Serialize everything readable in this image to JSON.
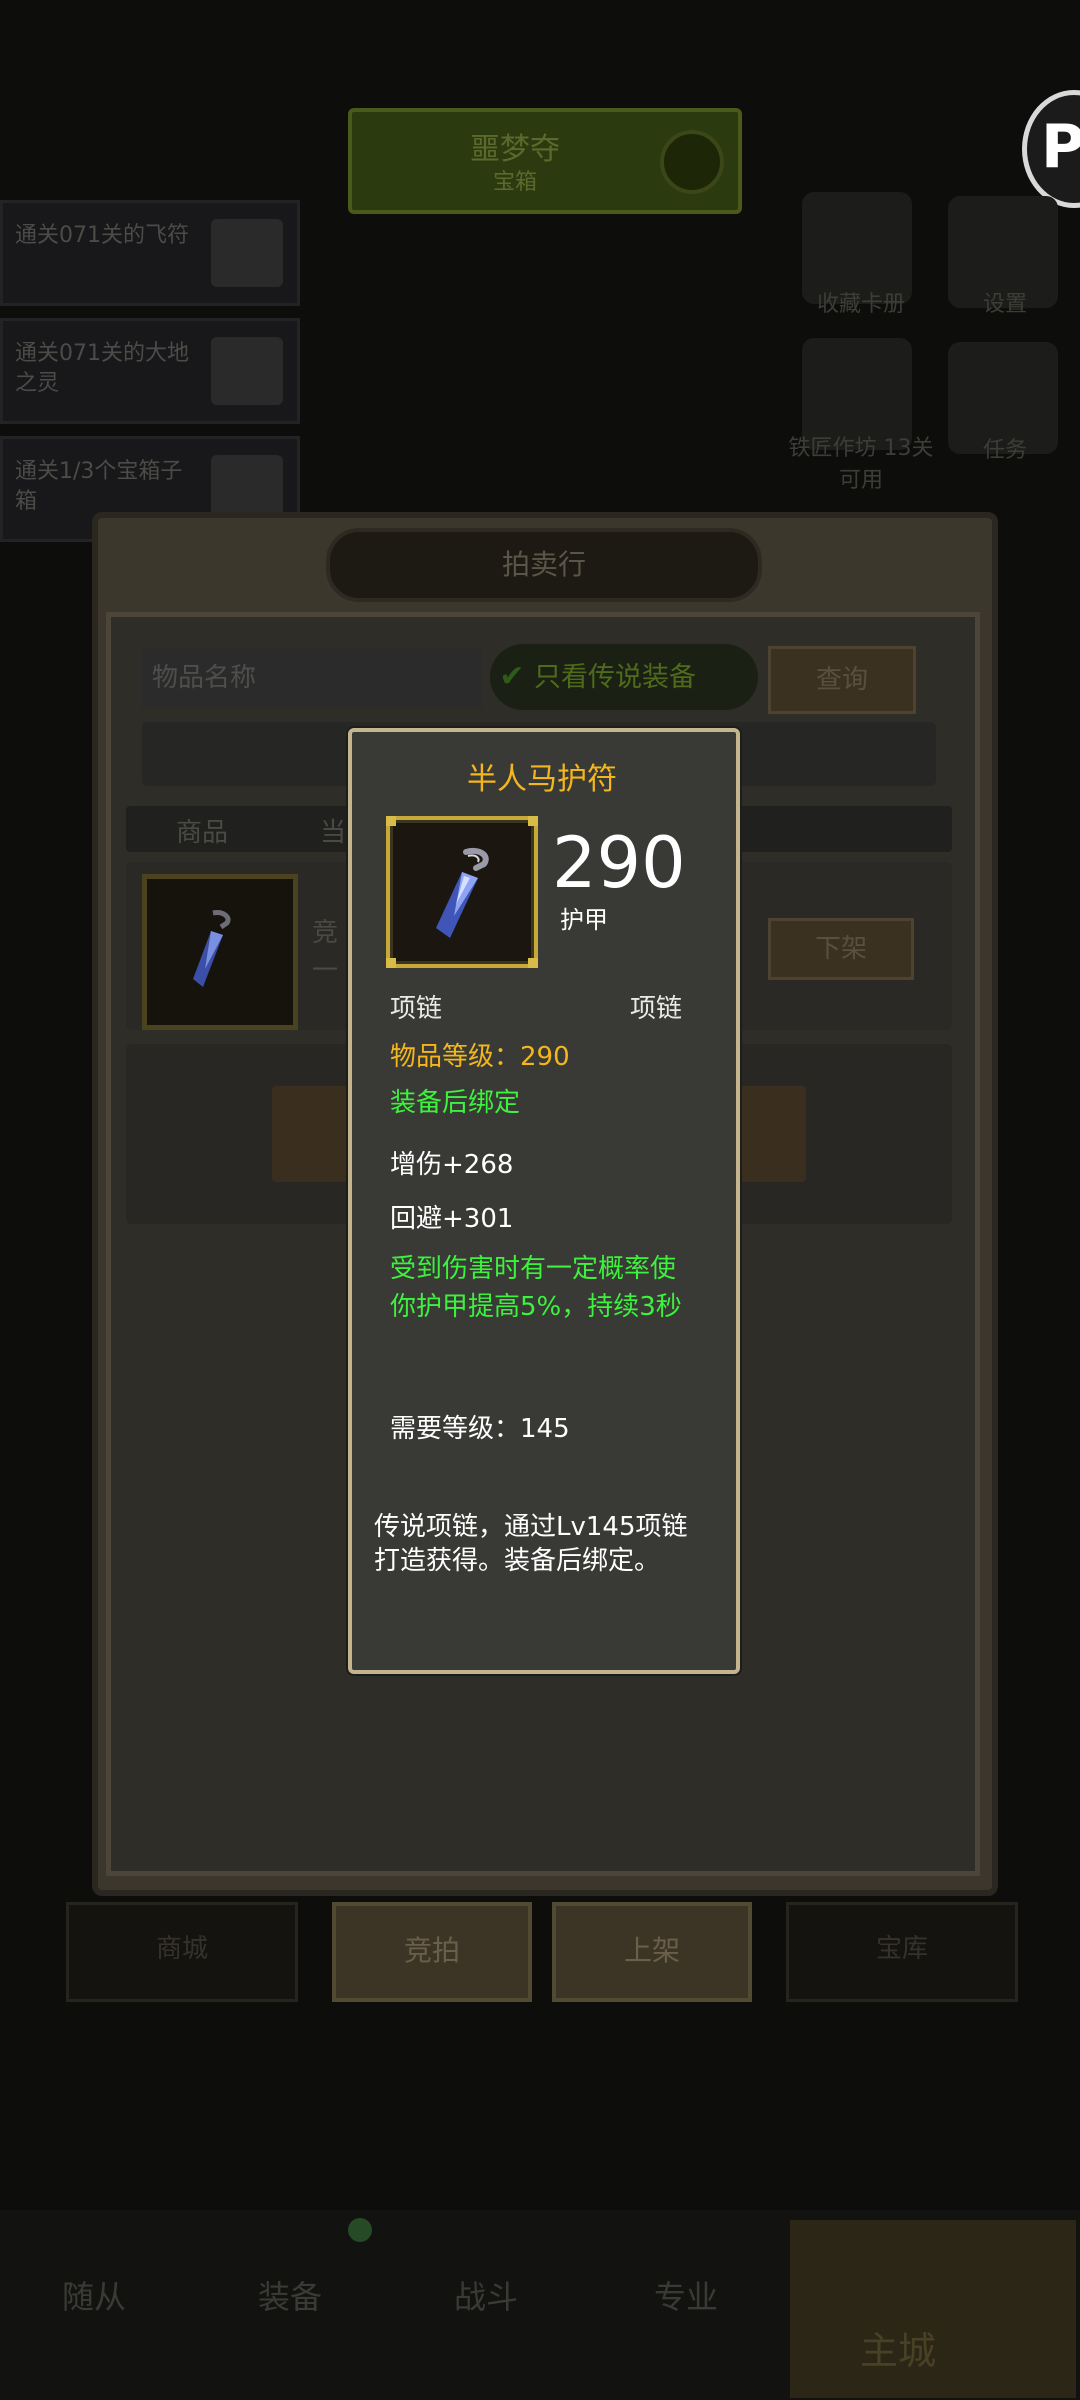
{
  "background": {
    "banner": {
      "line1": "噩梦夺",
      "line2": "宝箱"
    },
    "quests": [
      {
        "text": "通关071关的飞符"
      },
      {
        "text": "通关071关的大地之灵"
      },
      {
        "text": "通关1/3个宝箱子箱"
      }
    ],
    "side_labels": [
      "收藏卡册",
      "设置",
      "铁匠作坊 13关可用",
      "任务"
    ],
    "corner_logo": "P"
  },
  "auction": {
    "title": "拍卖行",
    "search_placeholder": "物品名称",
    "legendary_only_label": "只看传说装备",
    "query_button": "查询",
    "col_item": "商品",
    "col_current": "当",
    "row_bid_text": "竞",
    "row_dash": "一",
    "takedown_button": "下架"
  },
  "bottom_tabs": {
    "shop": "商城",
    "bid": "竞拍",
    "list": "上架",
    "vault": "宝库"
  },
  "nav": {
    "followers": "随从",
    "equipment": "装备",
    "battle": "战斗",
    "profession": "专业",
    "main_city": "主城"
  },
  "tooltip": {
    "name": "半人马护符",
    "value": "290",
    "value_label": "护甲",
    "slot_left": "项链",
    "slot_right": "项链",
    "item_level": "物品等级：290",
    "bind": "装备后绑定",
    "stat1": "增伤+268",
    "stat2": "回避+301",
    "effect": "受到伤害时有一定概率使你护甲提高5%，持续3秒",
    "required_level": "需要等级：145",
    "description": "传说项链，通过Lv145项链打造获得。装备后绑定。"
  },
  "colors": {
    "legendary": "#f3b61c",
    "bound_green": "#3cf23c",
    "frame": "#c4b58e"
  }
}
